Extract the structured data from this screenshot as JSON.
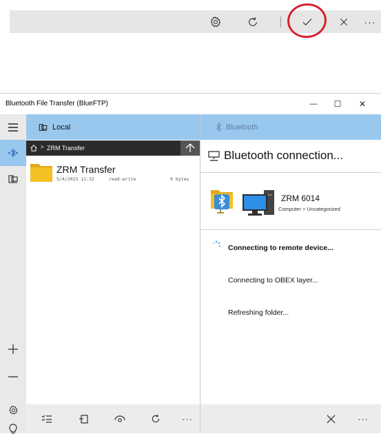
{
  "toolbar": {
    "settings_icon": "gear-icon",
    "refresh_icon": "refresh-icon",
    "confirm_icon": "checkmark-icon",
    "close_icon": "close-icon",
    "more_label": "···",
    "highlight_color": "#d8202c"
  },
  "window": {
    "title": "Bluetooth File Transfer (BlueFTP)",
    "minimize_label": "—",
    "maximize_label": "☐",
    "close_label": "✕"
  },
  "local_pane": {
    "header_label": "Local",
    "breadcrumb": "ZRM Transfer",
    "files": [
      {
        "name": "ZRM Transfer",
        "date": "5/4/2023 11:32",
        "access": "read-write",
        "size": "0 bytes"
      }
    ]
  },
  "bluetooth_pane": {
    "header_label": "Bluetooth",
    "title": "Bluetooth connection...",
    "device_name": "ZRM 6014",
    "device_category": "Computer > Uncategorized",
    "steps": [
      {
        "label": "Connecting to remote device...",
        "active": true
      },
      {
        "label": "Connecting to OBEX layer...",
        "active": false
      },
      {
        "label": "Refreshing folder...",
        "active": false
      }
    ]
  },
  "bottom_more_label": "···",
  "colors": {
    "header_bg": "#99c8ee",
    "accent": "#3a8fd8",
    "folder": "#f5c023"
  }
}
